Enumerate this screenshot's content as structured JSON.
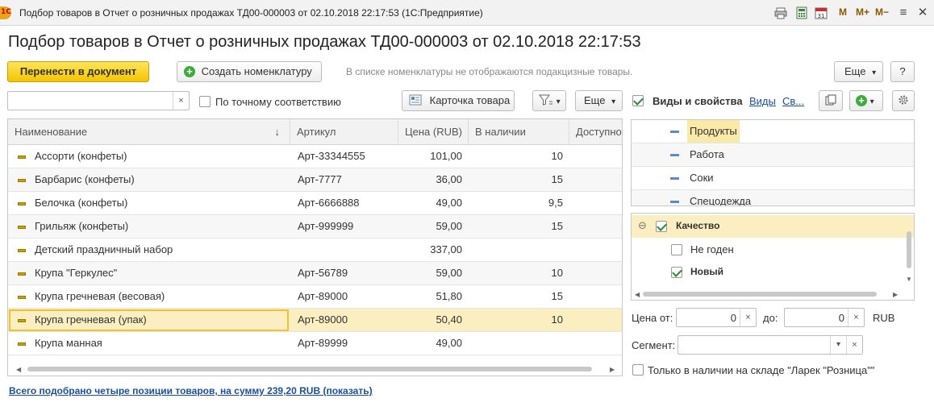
{
  "window": {
    "title": "Подбор товаров в Отчет о розничных продажах ТД00-000003 от 02.10.2018 22:17:53  (1С:Предприятие)",
    "logo_text": "1С",
    "mem_buttons": [
      "M",
      "M+",
      "M−"
    ],
    "menu_glyph": "≡",
    "close_glyph": "✕"
  },
  "heading": "Подбор товаров в Отчет о розничных продажах ТД00-000003 от 02.10.2018 22:17:53",
  "toolbar": {
    "transfer_label": "Перенести в документ",
    "create_label": "Создать номенклатуру",
    "hint": "В списке номенклатуры не отображаются подакцизные товары.",
    "more_label": "Еще",
    "help_label": "?",
    "plus_glyph": "+",
    "dropdown_glyph": "▾"
  },
  "search": {
    "value": "",
    "clear": "×",
    "exact_label": "По точному соответствию",
    "card_label": "Карточка товара",
    "more_label": "Еще"
  },
  "table": {
    "columns": [
      "Наименование",
      "Артикул",
      "Цена (RUB)",
      "В наличии",
      "Доступно"
    ],
    "sort_glyph": "↓",
    "rows": [
      {
        "name": "Ассорти (конфеты)",
        "article": "Арт-33344555",
        "price": "101,00",
        "stock": "10"
      },
      {
        "name": "Барбарис (конфеты)",
        "article": "Арт-7777",
        "price": "36,00",
        "stock": "15"
      },
      {
        "name": "Белочка (конфеты)",
        "article": "Арт-6666888",
        "price": "49,00",
        "stock": "9,5"
      },
      {
        "name": "Грильяж (конфеты)",
        "article": "Арт-999999",
        "price": "59,00",
        "stock": "15"
      },
      {
        "name": "Детский праздничный набор",
        "article": "",
        "price": "337,00",
        "stock": ""
      },
      {
        "name": "Крупа \"Геркулес\"",
        "article": "Арт-56789",
        "price": "59,00",
        "stock": "10"
      },
      {
        "name": "Крупа гречневая (весовая)",
        "article": "Арт-89000",
        "price": "51,80",
        "stock": "15"
      },
      {
        "name": "Крупа гречневая (упак)",
        "article": "Арт-89000",
        "price": "50,40",
        "stock": "10"
      },
      {
        "name": "Крупа манная",
        "article": "Арт-89999",
        "price": "49,00",
        "stock": ""
      }
    ],
    "selected_index": 7
  },
  "footer_link": "Всего подобрано четыре позиции товаров, на сумму 239,20 RUB (показать)",
  "right": {
    "types_label": "Виды и свойства",
    "types_link": "Виды",
    "props_link": "Св...",
    "categories": [
      "Продукты",
      "Работа",
      "Соки",
      "Спецодежда"
    ],
    "selected_category": 0,
    "quality": {
      "group": "Качество",
      "collapse_glyph": "⊖",
      "options": [
        {
          "label": "Не годен",
          "checked": false
        },
        {
          "label": "Новый",
          "checked": true
        }
      ]
    },
    "price_from_label": "Цена от:",
    "price_from_value": "0",
    "price_to_label": "до:",
    "price_to_value": "0",
    "currency": "RUB",
    "segment_label": "Сегмент:",
    "segment_value": "",
    "only_stock_label": "Только в наличии на складе \"Ларек \"Розница\"\""
  },
  "colors": {
    "accent_yellow": "#f3c500",
    "link_blue": "#1a4f9c",
    "selection": "#fbeec0",
    "check_green": "#2d8b2d"
  }
}
